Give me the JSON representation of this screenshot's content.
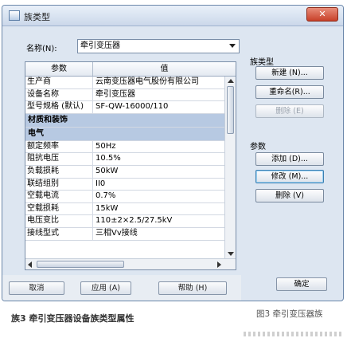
{
  "window": {
    "title": "族类型",
    "close_label": "✕"
  },
  "name_row": {
    "label": "名称(N):",
    "selected": "牵引变压器"
  },
  "table": {
    "headers": [
      "参数",
      "值"
    ],
    "rows": [
      {
        "type": "row",
        "param": "生产商",
        "value": "云南变压器电气股份有限公司"
      },
      {
        "type": "row",
        "param": "设备名称",
        "value": "牵引变压器"
      },
      {
        "type": "row",
        "param": "型号规格 (默认)",
        "value": "SF-QW-16000/110"
      },
      {
        "type": "group",
        "param": "材质和装饰",
        "value": ""
      },
      {
        "type": "group",
        "param": "电气",
        "value": ""
      },
      {
        "type": "row",
        "param": "额定频率",
        "value": "50Hz"
      },
      {
        "type": "row",
        "param": "阻抗电压",
        "value": "10.5%"
      },
      {
        "type": "row",
        "param": "负载损耗",
        "value": "50kW"
      },
      {
        "type": "row",
        "param": "联结组别",
        "value": "II0"
      },
      {
        "type": "row",
        "param": "空载电流",
        "value": "0.7%"
      },
      {
        "type": "row",
        "param": "空载损耗",
        "value": "15kW"
      },
      {
        "type": "row",
        "param": "电压变比",
        "value": "110±2×2.5/27.5kV"
      },
      {
        "type": "row",
        "param": "接线型式",
        "value": "三相Vv接线"
      }
    ]
  },
  "family_types": {
    "label": "族类型",
    "new_button": "新建 (N)...",
    "rename_button": "重命名(R)...",
    "delete_button": "删除 (E)"
  },
  "parameters": {
    "label": "参数",
    "add_button": "添加 (D)...",
    "modify_button": "修改 (M)...",
    "delete_button": "删除 (V)"
  },
  "bottom": {
    "cancel_button": "取消",
    "apply_button": "应用 (A)",
    "help_button": "帮助 (H)",
    "ok_button": "确定"
  },
  "captions": {
    "left": "族3  牵引变压器设备族类型属性",
    "right": "图3  牵引变压器族"
  },
  "colors": {
    "window_bg": "#dde6f1",
    "group_row_bg": "#b7c9e2",
    "close_button": "#c8412a"
  }
}
